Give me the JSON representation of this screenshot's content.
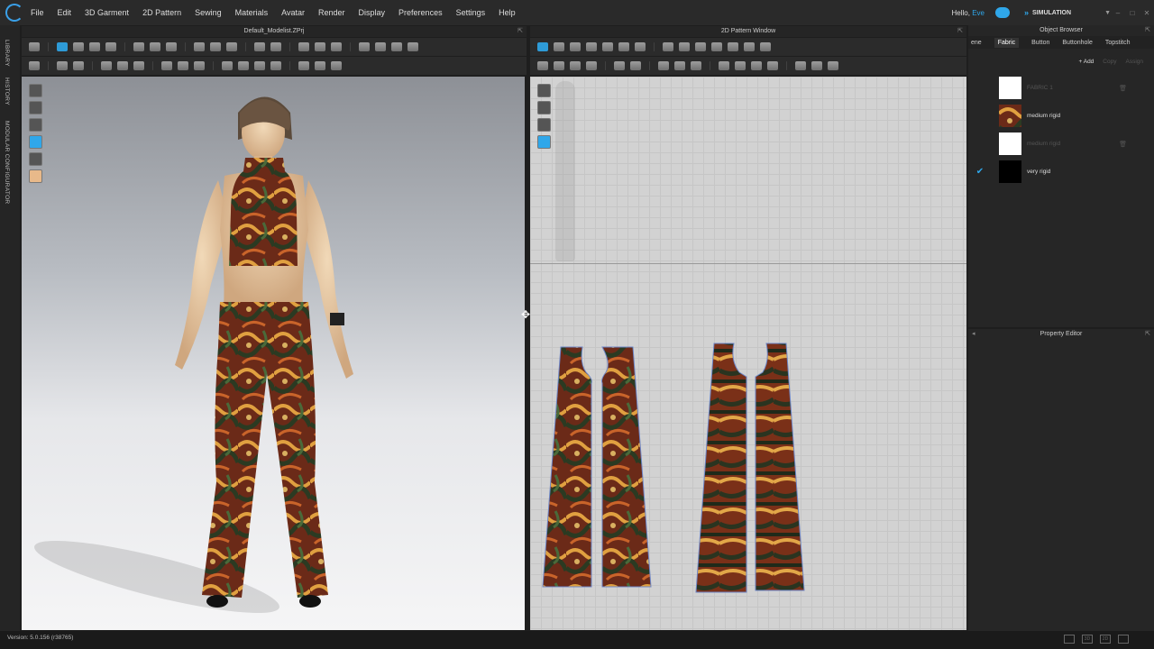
{
  "menu": [
    "File",
    "Edit",
    "3D Garment",
    "2D Pattern",
    "Sewing",
    "Materials",
    "Avatar",
    "Render",
    "Display",
    "Preferences",
    "Settings",
    "Help"
  ],
  "user": {
    "greeting": "Hello,",
    "name": "Eve"
  },
  "mode": {
    "label": "SIMULATION"
  },
  "sidebar_tabs": [
    "LIBRARY",
    "HISTORY",
    "MODULAR CONFIGURATOR"
  ],
  "view3d": {
    "title": "Default_Modelist.ZPrj"
  },
  "view2d": {
    "title": "2D Pattern Window"
  },
  "object_browser": {
    "title": "Object Browser",
    "tabs": [
      "ene",
      "Fabric",
      "Button",
      "Buttonhole",
      "Topstitch"
    ],
    "actions": {
      "add": "+ Add",
      "copy": "Copy",
      "assign": "Assign"
    },
    "fabrics": [
      {
        "name": "FABRIC 1",
        "swatch": "#ffffff",
        "dim": true,
        "selected": false,
        "deletable": true
      },
      {
        "name": "medium rigid",
        "swatch": "print",
        "dim": false,
        "selected": false,
        "deletable": false
      },
      {
        "name": "medium rigid",
        "swatch": "#ffffff",
        "dim": true,
        "selected": false,
        "deletable": true
      },
      {
        "name": "very rigid",
        "swatch": "#000000",
        "dim": false,
        "selected": true,
        "deletable": false
      }
    ]
  },
  "property_editor": {
    "title": "Property Editor"
  },
  "status": {
    "version": "Version: 5.0.156 (r38765)"
  },
  "colors": {
    "accent": "#2fa7ea",
    "print_a": "#b5441f",
    "print_b": "#2b3a22",
    "print_c": "#e0a040"
  }
}
